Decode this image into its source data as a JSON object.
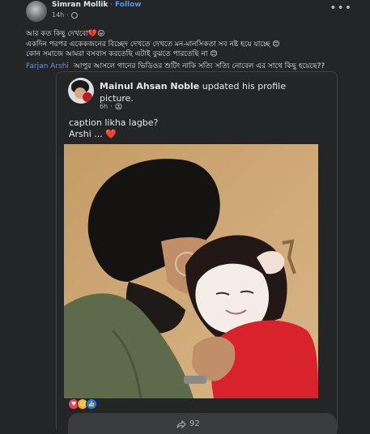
{
  "post": {
    "author": "Simran Mollik",
    "separator": " · ",
    "follow_label": "Follow",
    "time": "14h",
    "lines": [
      "আর কত কিছু দেখবো💔😛",
      "একদিন পরপর একেকজনের বিচ্ছেদ দেখতে দেখতে মন-মানসিকতা সব নষ্ট হয়ে যাচ্ছে 😊",
      "কোন সমাজে আমরা বসবাস করতেছি এটাই বুঝতে পারতেছি না 😊"
    ],
    "mention": "Farjan Arshi",
    "mention_text": "আপুর আসলে গানের ভিডিওর শুটিং নাকি সত্যি সত্যি নোবেল এর সাথে কিছু হয়েছে??"
  },
  "shared": {
    "author": "Mainul Ahsan Noble",
    "action": " updated his profile picture.",
    "time": "6h",
    "caption_line1": "caption likha lagbe?",
    "caption_line2": "Arshi ...",
    "heart": "❤️"
  },
  "footer": {
    "share_count": "92"
  },
  "icons": {
    "post_avatar": "avatar-icon",
    "more": "more-options-icon",
    "globe": "globe-icon",
    "friends": "friends-icon",
    "love": "love-reaction-icon",
    "care": "care-reaction-icon",
    "like": "like-reaction-icon",
    "share": "share-icon"
  },
  "colors": {
    "background": "#242526",
    "link": "#4599ff",
    "text": "#e4e6eb",
    "secondary": "#b0b3b8"
  }
}
